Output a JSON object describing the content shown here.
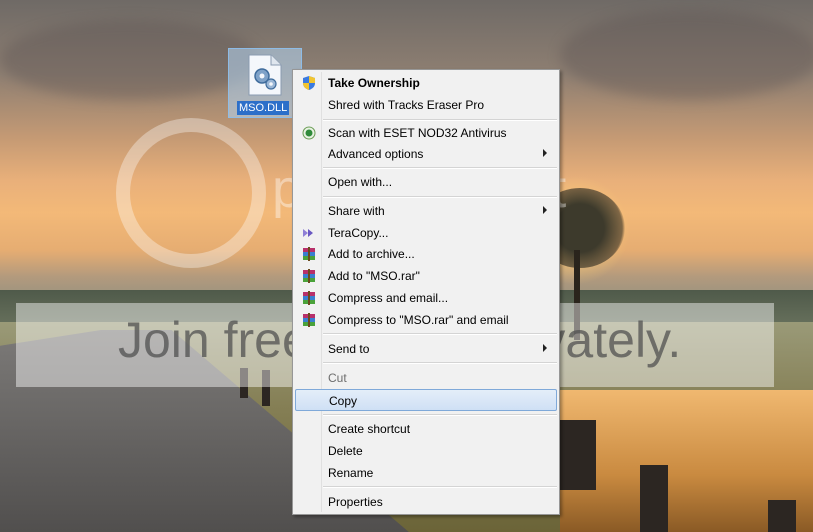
{
  "desktop": {
    "file_label": "MSO.DLL",
    "watermark_brand": "photobucket",
    "watermark_tagline": "Join free. Share privately."
  },
  "context_menu": {
    "items": [
      {
        "label": "Take Ownership",
        "icon": "uac-shield-icon",
        "bold": true
      },
      {
        "label": "Shred with Tracks Eraser Pro"
      },
      {
        "label": "Scan with ESET NOD32 Antivirus",
        "icon": "eset-icon"
      },
      {
        "label": "Advanced options",
        "submenu": true
      },
      {
        "label": "Open with..."
      },
      {
        "label": "Share with",
        "submenu": true
      },
      {
        "label": "TeraCopy...",
        "icon": "teracopy-icon"
      },
      {
        "label": "Add to archive...",
        "icon": "winrar-icon"
      },
      {
        "label": "Add to \"MSO.rar\"",
        "icon": "winrar-icon"
      },
      {
        "label": "Compress and email...",
        "icon": "winrar-icon"
      },
      {
        "label": "Compress to \"MSO.rar\" and email",
        "icon": "winrar-icon"
      },
      {
        "label": "Send to",
        "submenu": true
      },
      {
        "label": "Cut",
        "disabled": true
      },
      {
        "label": "Copy",
        "selected": true
      },
      {
        "label": "Create shortcut"
      },
      {
        "label": "Delete"
      },
      {
        "label": "Rename"
      },
      {
        "label": "Properties"
      }
    ]
  },
  "colors": {
    "menu_bg": "#f1f1f1",
    "selection_border": "#7fa9d9",
    "icon_selection": "#2c6fc9"
  }
}
